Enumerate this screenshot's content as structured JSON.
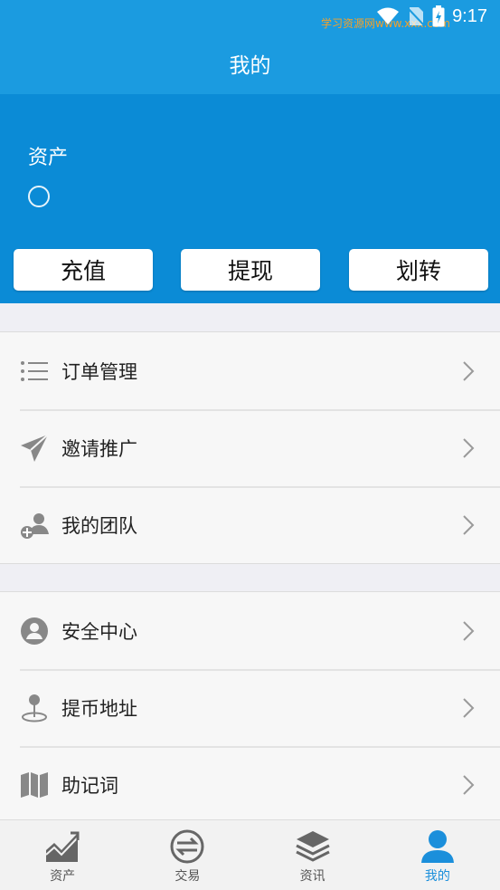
{
  "status_bar": {
    "watermark": "学习资源网www.xxx.com",
    "time": "9:17"
  },
  "header": {
    "title": "我的"
  },
  "assets": {
    "label": "资产",
    "buttons": {
      "recharge": "充值",
      "withdraw": "提现",
      "transfer": "划转"
    }
  },
  "menu_group_1": [
    {
      "label": "订单管理",
      "icon": "list-icon"
    },
    {
      "label": "邀请推广",
      "icon": "paper-plane-icon"
    },
    {
      "label": "我的团队",
      "icon": "add-user-icon"
    }
  ],
  "menu_group_2": [
    {
      "label": "安全中心",
      "icon": "user-circle-icon"
    },
    {
      "label": "提币地址",
      "icon": "location-pin-icon"
    },
    {
      "label": "助记词",
      "icon": "map-icon"
    }
  ],
  "tab_bar": {
    "tabs": [
      {
        "label": "资产",
        "icon": "chart-icon"
      },
      {
        "label": "交易",
        "icon": "exchange-icon"
      },
      {
        "label": "资讯",
        "icon": "layers-icon"
      },
      {
        "label": "我的",
        "icon": "user-icon"
      }
    ],
    "active": "我的"
  },
  "colors": {
    "primary": "#1b9be0",
    "panel": "#0b8bd6",
    "active_tab": "#1b8fdb"
  }
}
